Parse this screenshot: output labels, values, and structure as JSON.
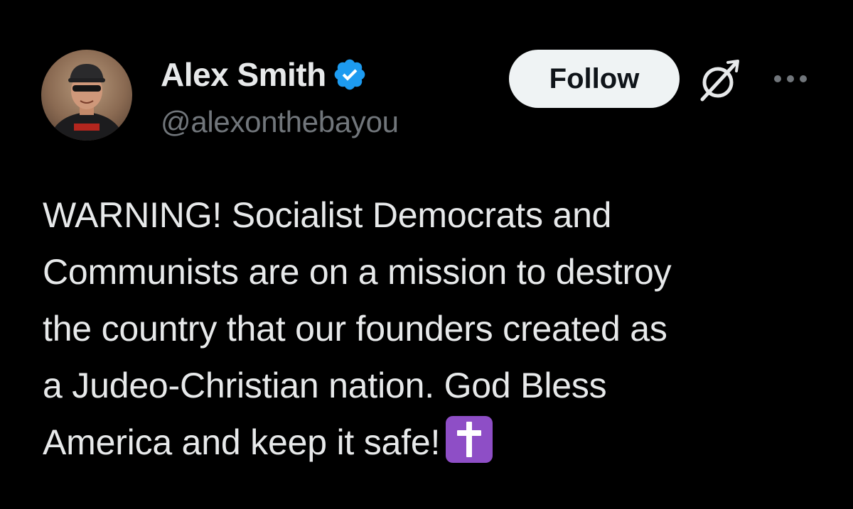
{
  "author": {
    "display_name": "Alex Smith",
    "handle": "@alexonthebayou",
    "verified": true,
    "verified_badge_color": "#1d9bf0",
    "avatar_icon": "user-avatar-photo"
  },
  "actions": {
    "follow_label": "Follow",
    "grok_icon": "grok-icon",
    "more_icon": "more-dots-icon"
  },
  "post": {
    "lines": [
      "WARNING!  Socialist Democrats and",
      "Communists are on a mission to destroy",
      "the country that our founders created as",
      "a Judeo-Christian nation. God Bless",
      "America and keep it safe!"
    ],
    "emoji": "latin-cross-emoji",
    "emoji_color": "#8e4ec6"
  },
  "colors": {
    "background": "#000000",
    "text_primary": "#e7e9ea",
    "text_secondary": "#71767b",
    "follow_bg": "#eff3f4",
    "follow_text": "#0f1419"
  }
}
